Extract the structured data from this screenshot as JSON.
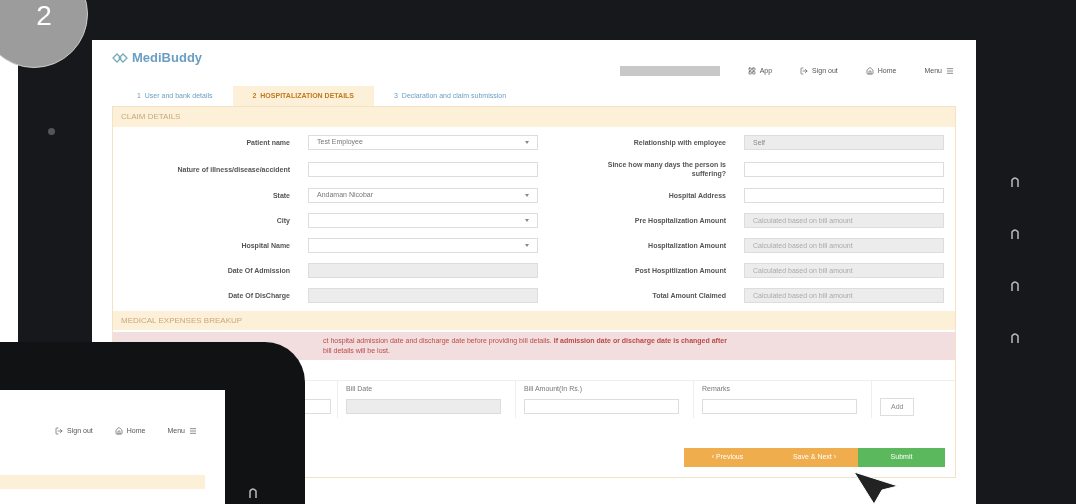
{
  "badge": "2",
  "logo": "MediBuddy",
  "nav": [
    {
      "kind": "app",
      "label": "App"
    },
    {
      "kind": "signout",
      "label": "Sign out"
    },
    {
      "kind": "home",
      "label": "Home"
    },
    {
      "kind": "menu",
      "label": "Menu"
    }
  ],
  "tabs": [
    {
      "number": "1",
      "label": "User and bank details",
      "selected": false
    },
    {
      "number": "2",
      "label": "HOSPITALIZATION DETAILS",
      "selected": true
    },
    {
      "number": "3",
      "label": "Declaration and claim submission",
      "selected": false
    }
  ],
  "claim_details": {
    "title": "CLAIM DETAILS",
    "left": [
      {
        "label": "Patient name",
        "kind": "select",
        "value": "Test Employee"
      },
      {
        "label": "Nature of illness/disease/accident",
        "kind": "input"
      },
      {
        "label": "State",
        "kind": "select",
        "value": "Andaman Nicobar"
      },
      {
        "label": "City",
        "kind": "select"
      },
      {
        "label": "Hospital Name",
        "kind": "select"
      },
      {
        "label": "Date Of Admission",
        "kind": "readonly"
      },
      {
        "label": "Date Of DisCharge",
        "kind": "readonly"
      }
    ],
    "right": [
      {
        "label": "Relationship with employee",
        "kind": "readonly",
        "value": "Self"
      },
      {
        "label": "Since how many days the person is suffering?",
        "kind": "input"
      },
      {
        "label": "Hospital Address",
        "kind": "input"
      },
      {
        "label": "Pre Hospitalization Amount",
        "kind": "readonly",
        "placeholder": "Calculated based on bill amount"
      },
      {
        "label": "Hospitalization Amount",
        "kind": "readonly",
        "placeholder": "Calculated based on bill amount"
      },
      {
        "label": "Post Hospitlization Amount",
        "kind": "readonly",
        "placeholder": "Calculated based on bill amount"
      },
      {
        "label": "Total Amount Claimed",
        "kind": "readonly",
        "placeholder": "Calculated based on bill amount"
      }
    ]
  },
  "medical_expenses": {
    "title": "MEDICAL EXPENSES BREAKUP",
    "warning": [
      "ct hospital admission date and discharge date before providing bill details. **If admission date or discharge date is changed after**",
      "bill details will be lost."
    ],
    "columns": [
      "Bill Date",
      "Bill Amount(In Rs.)",
      "Remarks"
    ],
    "row": [
      {
        "kind": "input"
      },
      {
        "kind": "readonly"
      },
      {
        "kind": "input"
      },
      {
        "kind": "input"
      }
    ],
    "add_button": "Add"
  },
  "buttons": [
    {
      "label": "‹ Previous",
      "kind": "warning"
    },
    {
      "label": "Save & Next ›",
      "kind": "warning"
    },
    {
      "label": "Submit",
      "kind": "success"
    }
  ],
  "second_tablet": {
    "nav": [
      {
        "kind": "signout",
        "label": "Sign out"
      },
      {
        "kind": "home",
        "label": "Home"
      },
      {
        "kind": "menu",
        "label": "Menu"
      }
    ]
  }
}
